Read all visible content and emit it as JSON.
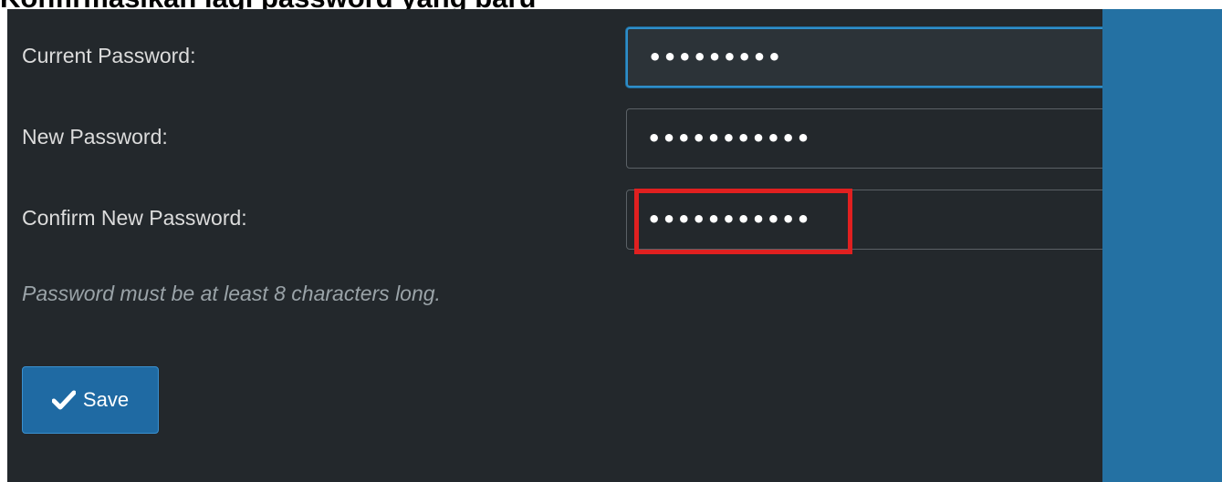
{
  "caption": "Konfirmasikan lagi password yang baru",
  "form": {
    "current_password": {
      "label": "Current Password:",
      "masked_value": "•••••••••"
    },
    "new_password": {
      "label": "New Password:",
      "masked_value": "•••••••••••"
    },
    "confirm_password": {
      "label": "Confirm New Password:",
      "masked_value": "•••••••••••"
    },
    "hint": "Password must be at least 8 characters long.",
    "save_label": "Save"
  },
  "icons": {
    "save": "checkmark-icon"
  },
  "colors": {
    "panel_bg": "#23282c",
    "side_bg": "#2471a3",
    "focus_border": "#2f8ec9",
    "button_bg": "#1f6aa3",
    "highlight": "#e02020"
  }
}
